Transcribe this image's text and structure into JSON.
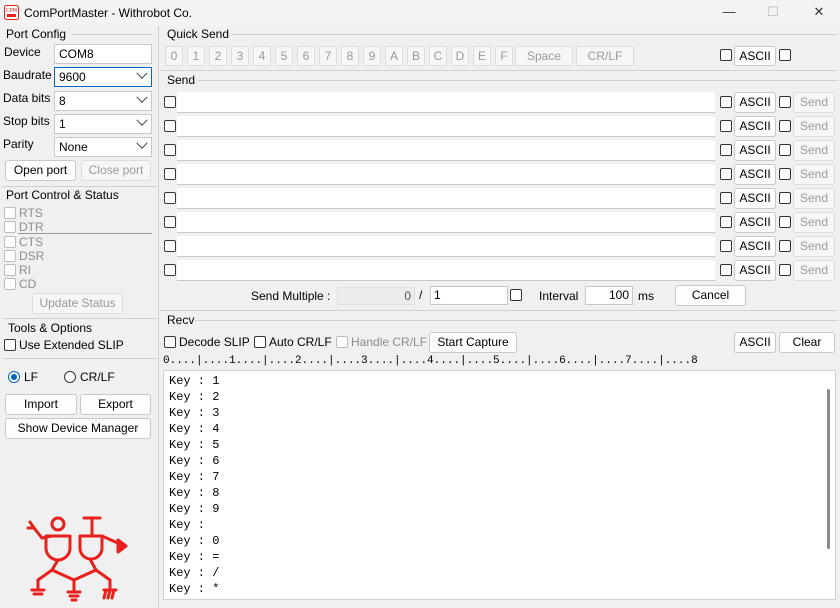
{
  "window": {
    "title": "ComPortMaster - Withrobot Co.",
    "minimize": "—",
    "maximize": "☐",
    "close": "✕",
    "brand_color": "#e8201c",
    "app_icon": "app-logo-icon"
  },
  "port_config": {
    "title": "Port Config",
    "device_label": "Device",
    "device_value": "COM8",
    "baudrate_label": "Baudrate",
    "baudrate_value": "9600",
    "databits_label": "Data bits",
    "databits_value": "8",
    "stopbits_label": "Stop bits",
    "stopbits_value": "1",
    "parity_label": "Parity",
    "parity_value": "None",
    "open_port": "Open port",
    "close_port": "Close port"
  },
  "port_control": {
    "title": "Port Control & Status",
    "rts": "RTS",
    "dtr": "DTR",
    "cts": "CTS",
    "dsr": "DSR",
    "ri": "RI",
    "cd": "CD",
    "update_status": "Update Status"
  },
  "tools": {
    "title": "Tools & Options",
    "extended_slip": "Use Extended SLIP",
    "lf": "LF",
    "crlf": "CR/LF",
    "import": "Import",
    "export": "Export",
    "device_manager": "Show Device Manager"
  },
  "quick_send": {
    "title": "Quick Send",
    "keys": [
      "0",
      "1",
      "2",
      "3",
      "4",
      "5",
      "6",
      "7",
      "8",
      "9",
      "A",
      "B",
      "C",
      "D",
      "E",
      "F"
    ],
    "space": "Space",
    "crlf": "CR/LF",
    "ascii": "ASCII"
  },
  "send": {
    "title": "Send",
    "ascii": "ASCII",
    "send_label": "Send",
    "rows": [
      "",
      "",
      "",
      "",
      "",
      "",
      "",
      ""
    ],
    "multiple_label": "Send Multiple :",
    "progress_value": "0",
    "separator": "/",
    "count_value": "1",
    "interval_label": "Interval",
    "interval_value": "100",
    "interval_unit": "ms",
    "cancel": "Cancel"
  },
  "recv": {
    "title": "Recv",
    "decode_slip": "Decode SLIP",
    "auto_crlf": "Auto CR/LF",
    "handle_crlf": "Handle CR/LF",
    "start_capture": "Start Capture",
    "ascii": "ASCII",
    "clear": "Clear",
    "ruler": "0....|....1....|....2....|....3....|....4....|....5....|....6....|....7....|....8",
    "lines": [
      "Key : 1",
      "Key : 2",
      "Key : 3",
      "Key : 4",
      "Key : 5",
      "Key : 6",
      "Key : 7",
      "Key : 8",
      "Key : 9",
      "Key :  ",
      "Key : 0",
      "Key : =",
      "Key : /",
      "Key : *"
    ]
  }
}
